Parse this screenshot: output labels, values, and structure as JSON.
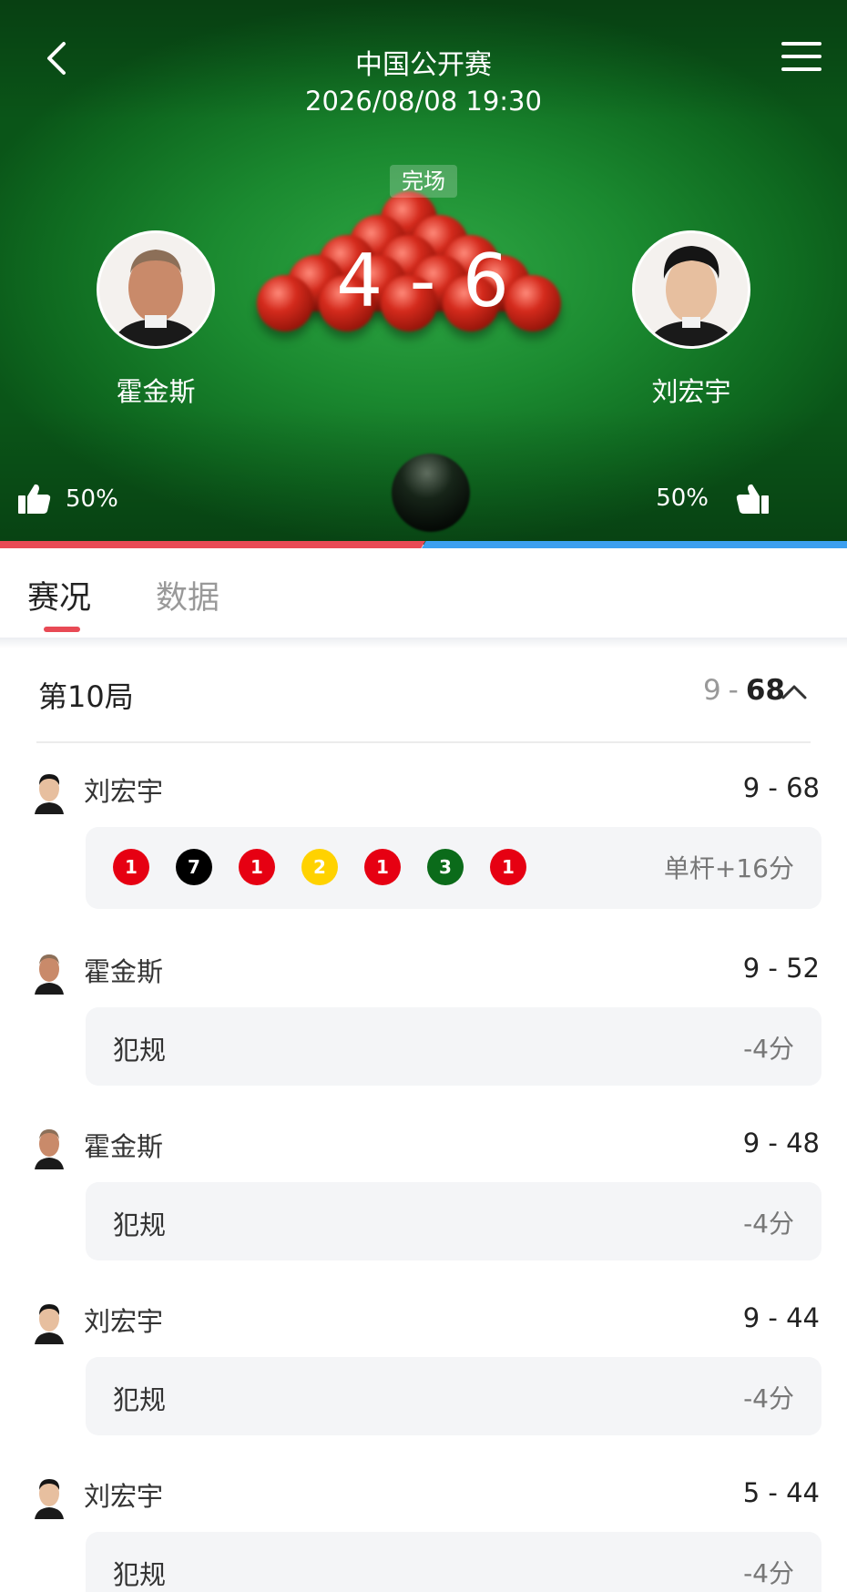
{
  "header": {
    "event_title": "中国公开赛",
    "event_time": "2026/08/08 19:30",
    "status": "完场",
    "score": "4 - 6",
    "player_left": {
      "name": "霍金斯",
      "support": "50%"
    },
    "player_right": {
      "name": "刘宏宇",
      "support": "50%"
    },
    "vote_split": {
      "left": 0.5,
      "right": 0.5
    },
    "colors": {
      "left": "#e84a55",
      "right": "#3ca0f0"
    }
  },
  "tabs": [
    {
      "label": "赛况",
      "active": true
    },
    {
      "label": "数据",
      "active": false
    }
  ],
  "frame": {
    "title": "第10局",
    "score_left": "9",
    "score_sep": "-",
    "score_right": "68"
  },
  "events": [
    {
      "player": "刘宏宇",
      "score": "9 - 68",
      "type": "break",
      "balls": [
        {
          "value": "1",
          "color": "#e60012"
        },
        {
          "value": "7",
          "color": "#000000"
        },
        {
          "value": "1",
          "color": "#e60012"
        },
        {
          "value": "2",
          "color": "#ffd200"
        },
        {
          "value": "1",
          "color": "#e60012"
        },
        {
          "value": "3",
          "color": "#0b6b1a"
        },
        {
          "value": "1",
          "color": "#e60012"
        }
      ],
      "points": "单杆+16分"
    },
    {
      "player": "霍金斯",
      "score": "9 - 52",
      "type": "foul",
      "desc": "犯规",
      "points": "-4分"
    },
    {
      "player": "霍金斯",
      "score": "9 - 48",
      "type": "foul",
      "desc": "犯规",
      "points": "-4分"
    },
    {
      "player": "刘宏宇",
      "score": "9 - 44",
      "type": "foul",
      "desc": "犯规",
      "points": "-4分"
    },
    {
      "player": "刘宏宇",
      "score": "5 - 44",
      "type": "foul",
      "desc": "犯规",
      "points": "-4分"
    }
  ]
}
